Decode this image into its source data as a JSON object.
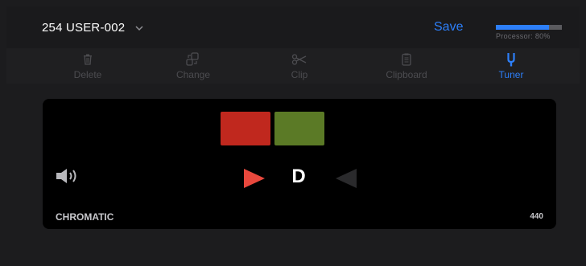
{
  "header": {
    "preset_name": "254 USER-002",
    "save_label": "Save",
    "processor_label": "Processor: 80%",
    "processor_level": 0.8
  },
  "toolbar": {
    "items": [
      {
        "label": "Delete",
        "icon": "trash-icon",
        "active": false
      },
      {
        "label": "Change",
        "icon": "change-icon",
        "active": false
      },
      {
        "label": "Clip",
        "icon": "scissors-icon",
        "active": false
      },
      {
        "label": "Clipboard",
        "icon": "clipboard-icon",
        "active": false
      },
      {
        "label": "Tuner",
        "icon": "tuning-fork-icon",
        "active": true
      }
    ]
  },
  "tuner": {
    "note": "D",
    "mode": "CHROMATIC",
    "reference": "440",
    "colors": {
      "flat_block": "#c0281e",
      "sharp_block": "#5b7a26",
      "left_arrow": "#e8483d",
      "right_arrow": "#2a2a2c"
    }
  }
}
